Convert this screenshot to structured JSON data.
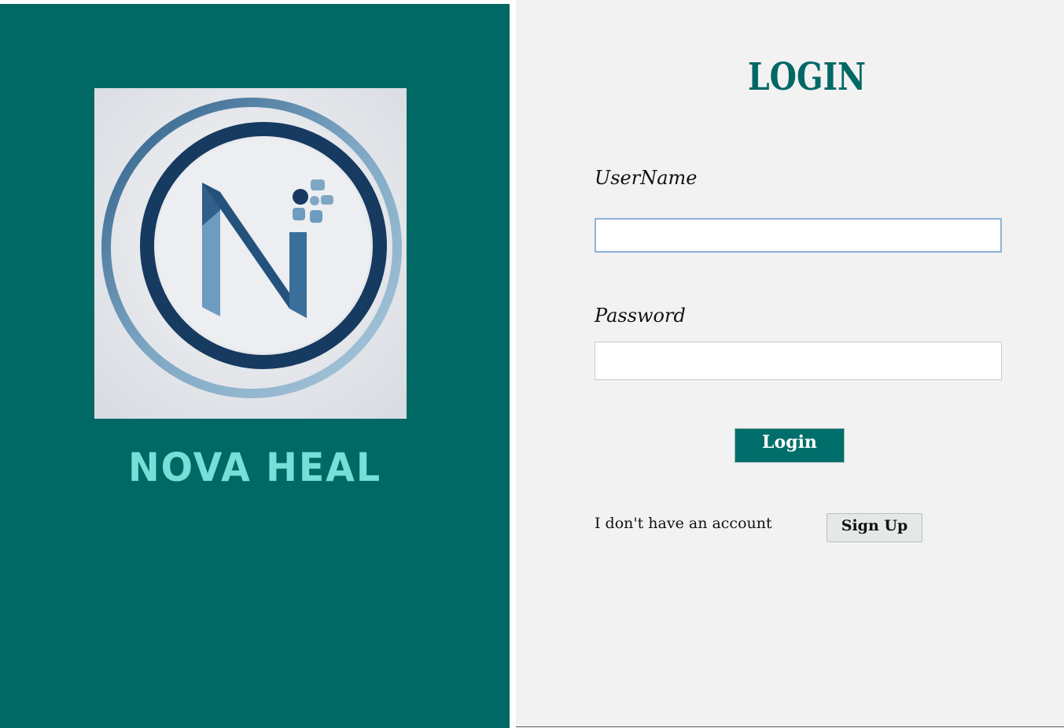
{
  "brand": {
    "name": "NOVA HEAL",
    "logo_icon": "nova-heal-n-circle-logo",
    "logo_letter": "N"
  },
  "login": {
    "title": "LOGIN",
    "username_label": "UserName",
    "username_value": "",
    "password_label": "Password",
    "password_value": "",
    "login_button_label": "Login",
    "no_account_text": "I don't have an account",
    "signup_button_label": "Sign Up"
  },
  "colors": {
    "primary_teal": "#006865",
    "brand_text": "#76e0d8",
    "panel_background": "#f2f2f2",
    "logo_dark_blue": "#1f3f6a",
    "logo_light_blue": "#8fb3ca"
  }
}
